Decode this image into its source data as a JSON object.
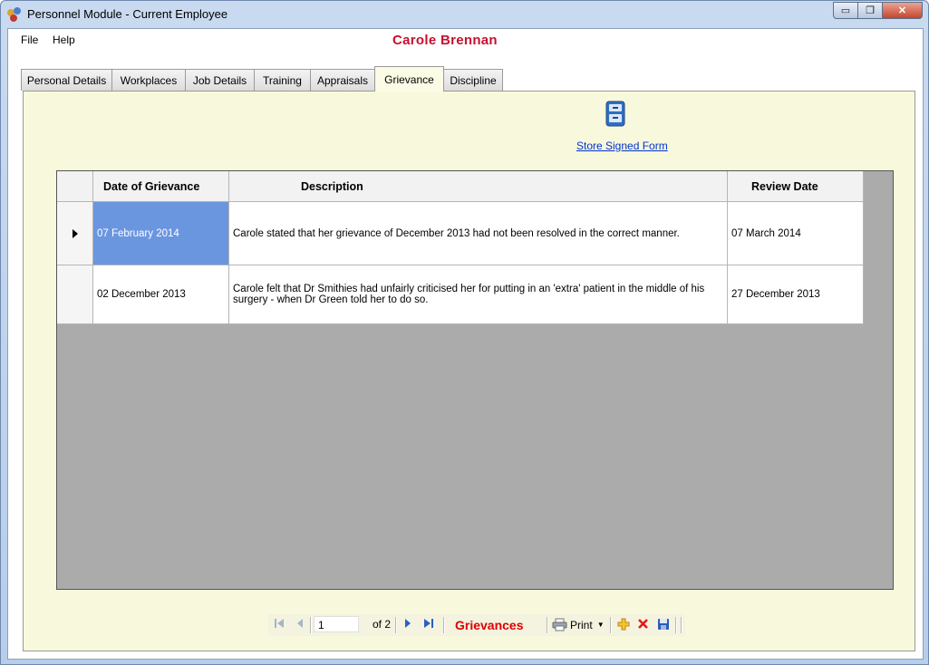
{
  "window": {
    "title": "Personnel Module - Current Employee",
    "minimize": "▭",
    "restore": "❐",
    "close": "✕"
  },
  "menu": {
    "file": "File",
    "help": "Help"
  },
  "employee_name": "Carole Brennan",
  "tabs": [
    {
      "label": "Personal Details"
    },
    {
      "label": "Workplaces"
    },
    {
      "label": "Job Details"
    },
    {
      "label": "Training"
    },
    {
      "label": "Appraisals"
    },
    {
      "label": "Grievance",
      "active": true
    },
    {
      "label": "Discipline"
    }
  ],
  "store_signed_form": "Store Signed Form",
  "grid": {
    "columns": [
      "Date of Grievance",
      "Description",
      "Review Date"
    ],
    "rows": [
      {
        "date": "07 February 2014",
        "description": "Carole stated that her grievance of December 2013 had not been resolved in the correct manner.",
        "review": "07 March 2014",
        "current": true
      },
      {
        "date": "02 December 2013",
        "description": "Carole felt that Dr Smithies had unfairly criticised her for putting in an 'extra' patient in the middle of his surgery - when Dr Green told her to do so.",
        "review": "27 December 2013",
        "current": false
      }
    ]
  },
  "navigator": {
    "position": "1",
    "of_label": "of 2",
    "title": "Grievances",
    "print": "Print"
  },
  "colors": {
    "employee_name": "#c8102e",
    "selection": "#6a96e0",
    "panel_bg": "#f8f8dc",
    "grid_bg": "#ababab"
  }
}
